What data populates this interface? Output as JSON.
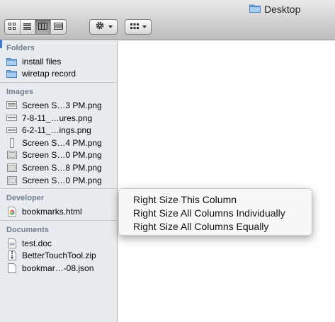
{
  "window": {
    "title": "Desktop",
    "title_icon": "folder-icon"
  },
  "toolbar": {
    "view_buttons": [
      {
        "name": "icon-view-button",
        "icon": "grid-icon"
      },
      {
        "name": "list-view-button",
        "icon": "list-icon"
      },
      {
        "name": "column-view-button",
        "icon": "columns-icon",
        "active": true
      },
      {
        "name": "coverflow-view-button",
        "icon": "coverflow-icon"
      }
    ],
    "action_button": {
      "icon": "gear-icon"
    },
    "arrange_button": {
      "icon": "arrange-grid-icon"
    }
  },
  "sidebar": {
    "sections": [
      {
        "header": "Folders",
        "items": [
          {
            "label": "install files",
            "icon": "folder-icon"
          },
          {
            "label": "wiretap record",
            "icon": "folder-icon"
          }
        ]
      },
      {
        "header": "Images",
        "items": [
          {
            "label": "Screen S…3 PM.png",
            "icon": "image-file-icon"
          },
          {
            "label": "7-8-11_…ures.png",
            "icon": "image-file-icon"
          },
          {
            "label": "6-2-11_…ings.png",
            "icon": "image-file-icon"
          },
          {
            "label": "Screen S…4 PM.png",
            "icon": "image-file-icon"
          },
          {
            "label": "Screen S…0 PM.png",
            "icon": "image-file-icon"
          },
          {
            "label": "Screen S…8 PM.png",
            "icon": "image-file-icon"
          },
          {
            "label": "Screen S…0 PM.png",
            "icon": "image-file-icon"
          }
        ]
      },
      {
        "header": "Developer",
        "items": [
          {
            "label": "bookmarks.html",
            "icon": "chrome-file-icon"
          }
        ]
      },
      {
        "header": "Documents",
        "items": [
          {
            "label": "test.doc",
            "icon": "document-icon"
          },
          {
            "label": "BetterTouchTool.zip",
            "icon": "zip-file-icon"
          },
          {
            "label": "bookmar…-08.json",
            "icon": "document-icon"
          }
        ]
      }
    ]
  },
  "context_menu": {
    "items": [
      "Right Size This Column",
      "Right Size All Columns Individually",
      "Right Size All Columns Equally"
    ]
  },
  "colors": {
    "sidebar_bg": "#e8ecf1",
    "section_header": "#707e8b",
    "selection_accent": "#3b7bd6"
  }
}
